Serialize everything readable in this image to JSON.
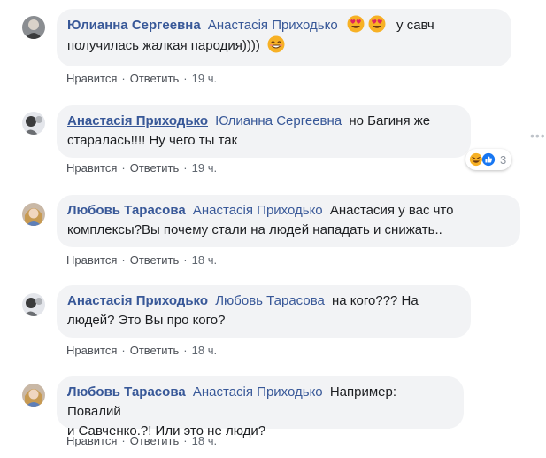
{
  "comments": [
    {
      "author": "Юлианна Сергеевна",
      "mention": "Анастасія Приходько",
      "text_after_emoji": "у савч",
      "line2": "получилась жалкая пародия))))",
      "like_label": "Нравится",
      "reply_label": "Ответить",
      "time": "19 ч."
    },
    {
      "author": "Анастасія Приходько",
      "mention": "Юлианна Сергеевна",
      "text1": "но Багиня же",
      "line2": "старалась!!!! Ну чего ты так",
      "like_label": "Нравится",
      "reply_label": "Ответить",
      "time": "19 ч.",
      "reaction_count": "3"
    },
    {
      "author": "Любовь Тарасова",
      "mention": "Анастасія Приходько",
      "text1": "Анастасия у вас что",
      "line2": "комплексы?Вы почему стали на людей нападать и снижать..",
      "like_label": "Нравится",
      "reply_label": "Ответить",
      "time": "18 ч."
    },
    {
      "author": "Анастасія Приходько",
      "mention": "Любовь Тарасова",
      "text1": "на кого??? На",
      "line2": "людей? Это Вы про кого?",
      "like_label": "Нравится",
      "reply_label": "Ответить",
      "time": "18 ч."
    },
    {
      "author": "Любовь Тарасова",
      "mention": "Анастасія Приходько",
      "text1": "Например: Повалий",
      "line2": "и Савченко.?! Или это не люди?",
      "like_label": "Нравится",
      "reply_label": "Ответить",
      "time": "18 ч."
    }
  ],
  "icons": {
    "emoji_heart_eyes": "heart-eyes-emoji",
    "emoji_smile": "smiling-emoji",
    "reaction_haha": "haha-reaction",
    "reaction_like": "like-reaction",
    "more": "more-options"
  },
  "colors": {
    "link_blue": "#385898",
    "bubble_bg": "#f2f3f5",
    "meta_gray": "#606770"
  }
}
